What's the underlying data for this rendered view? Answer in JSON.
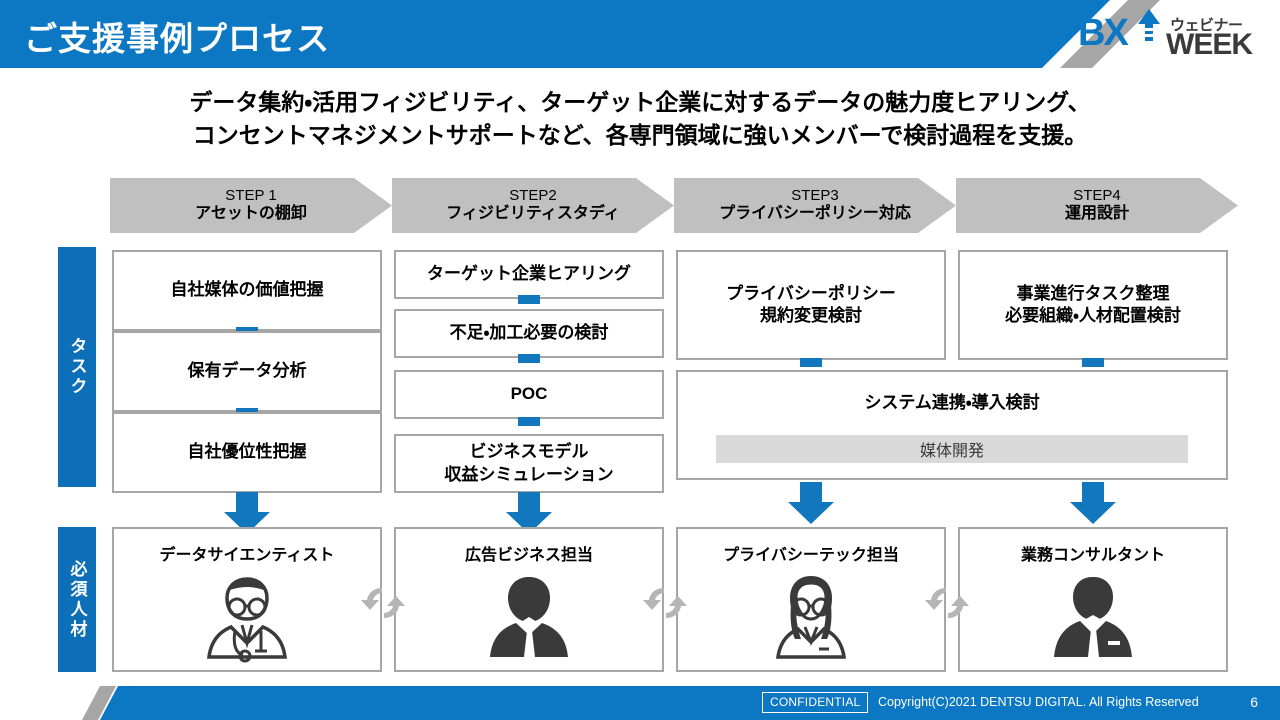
{
  "header": {
    "title": "ご支援事例プロセス",
    "logo": {
      "bx": "BX",
      "webinar": "ウェビナー",
      "week": "WEEK",
      "arrow_icon": "up-arrow-icon"
    },
    "colors": {
      "blue": "#0C78C4",
      "gray": "#A6A6A6",
      "logo_dark": "#3A3A3A"
    }
  },
  "subtitle": {
    "line1": "データ集約・活用フィジビリティ、ターゲット企業に対するデータの魅力度ヒアリング、",
    "line2": "コンセントマネジメントサポートなど、各専門領域に強いメンバーで検討過程を支援。"
  },
  "steps": [
    {
      "number": "STEP 1",
      "name": "アセットの棚卸"
    },
    {
      "number": "STEP2",
      "name": "フィジビリティスタディ"
    },
    {
      "number": "STEP3",
      "name": "プライバシーポリシー対応"
    },
    {
      "number": "STEP4",
      "name": "運用設計"
    }
  ],
  "row_labels": {
    "task": "タスク",
    "people": "必須人材"
  },
  "tasks": {
    "step1": [
      {
        "text": "自社媒体の価値把握"
      },
      {
        "text": "保有データ分析"
      },
      {
        "text": "自社優位性把握"
      }
    ],
    "step2": [
      {
        "text": "ターゲット企業ヒアリング"
      },
      {
        "text": "不足・加工必要の検討"
      },
      {
        "text": "POC"
      },
      {
        "line1": "ビジネスモデル",
        "line2": "収益シミュレーション"
      }
    ],
    "step3": [
      {
        "line1": "プライバシーポリシー",
        "line2": "規約変更検討"
      }
    ],
    "step4": [
      {
        "line1": "事業進行タスク整理",
        "line2": "必要組織・人材配置検討"
      }
    ],
    "shared": {
      "title": "システム連携・導入検討",
      "sub": "媒体開発"
    }
  },
  "people": [
    {
      "label": "データサイエンティスト",
      "icon": "data-scientist-avatar-icon"
    },
    {
      "label": "広告ビジネス担当",
      "icon": "businessman-avatar-icon"
    },
    {
      "label": "プライバシーテック担当",
      "icon": "businesswoman-avatar-icon"
    },
    {
      "label": "業務コンサルタント",
      "icon": "consultant-avatar-icon"
    }
  ],
  "footer": {
    "confidential": "CONFIDENTIAL",
    "copyright": "Copyright(C)2021 DENTSU DIGITAL. All Rights Reserved",
    "page": "6"
  }
}
